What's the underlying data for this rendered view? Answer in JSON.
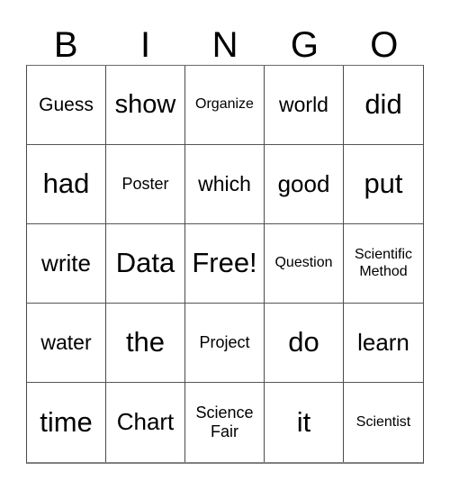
{
  "card": {
    "title_letters": [
      "B",
      "I",
      "N",
      "G",
      "O"
    ],
    "columns": 5,
    "rows": 5,
    "free_space_label": "Free!",
    "border_color": "#4a4a4a",
    "background_color": "#ffffff",
    "text_color": "#000000"
  },
  "grid": {
    "cells": [
      {
        "text": "Guess",
        "size": "fs-sm"
      },
      {
        "text": "show",
        "size": "fs-xl"
      },
      {
        "text": "Organize",
        "size": "fs-xxs"
      },
      {
        "text": "world",
        "size": "fs-md"
      },
      {
        "text": "did",
        "size": "fs-xxl"
      },
      {
        "text": "had",
        "size": "fs-xxl"
      },
      {
        "text": "Poster",
        "size": "fs-xs"
      },
      {
        "text": "which",
        "size": "fs-md"
      },
      {
        "text": "good",
        "size": "fs-lg"
      },
      {
        "text": "put",
        "size": "fs-xxl"
      },
      {
        "text": "write",
        "size": "fs-lg"
      },
      {
        "text": "Data",
        "size": "fs-xxl"
      },
      {
        "text": "Free!",
        "size": "fs-xxl"
      },
      {
        "text": "Question",
        "size": "fs-xxs"
      },
      {
        "text": "Scientific\nMethod",
        "size": "fs-two-s"
      },
      {
        "text": "water",
        "size": "fs-md"
      },
      {
        "text": "the",
        "size": "fs-xxl"
      },
      {
        "text": "Project",
        "size": "fs-xs"
      },
      {
        "text": "do",
        "size": "fs-xxl"
      },
      {
        "text": "learn",
        "size": "fs-lg"
      },
      {
        "text": "time",
        "size": "fs-xxl"
      },
      {
        "text": "Chart",
        "size": "fs-lg"
      },
      {
        "text": "Science\nFair",
        "size": "fs-two"
      },
      {
        "text": "it",
        "size": "fs-xxl"
      },
      {
        "text": "Scientist",
        "size": "fs-xxs"
      }
    ]
  }
}
